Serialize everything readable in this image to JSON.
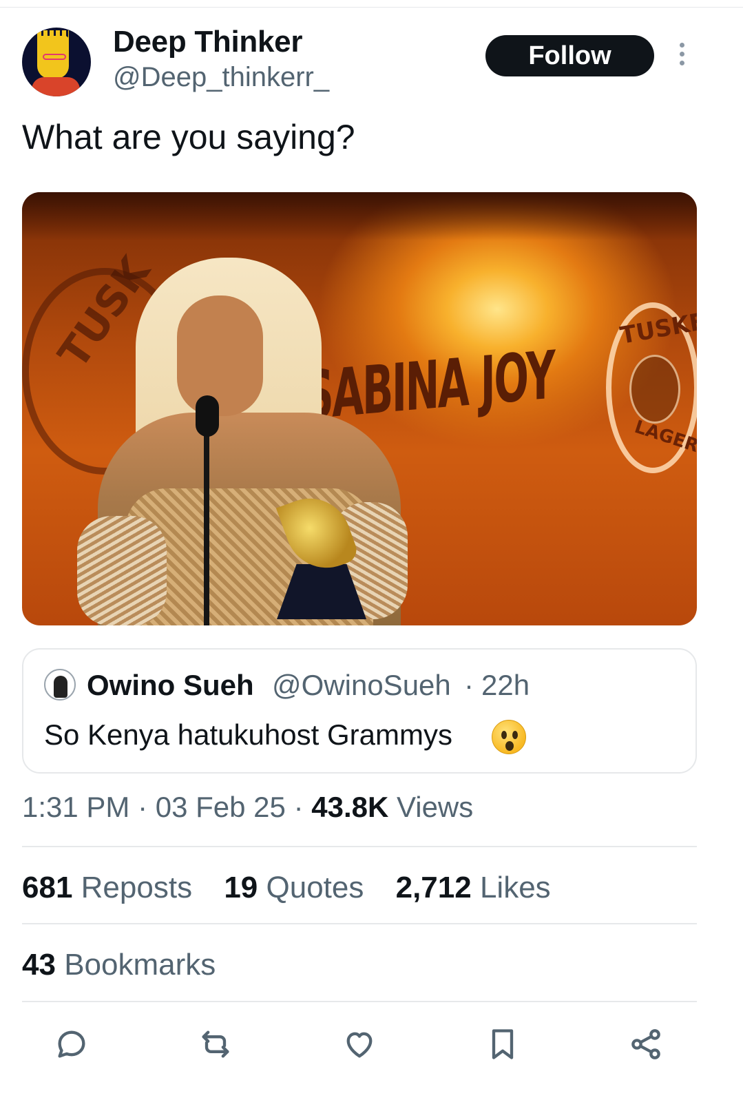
{
  "author": {
    "name": "Deep Thinker",
    "handle": "@Deep_thinkerr_",
    "follow_label": "Follow"
  },
  "tweet": {
    "text": "What are you saying?",
    "media": {
      "sign_text": "SABINA JOY",
      "logo_left_text": "TUSK",
      "logo_right_top": "TUSKER",
      "logo_right_bottom": "LAGER"
    }
  },
  "quote": {
    "name": "Owino Sueh",
    "handle": "@OwinoSueh",
    "separator": "·",
    "time": "22h",
    "text": "So Kenya hatukuhost Grammys",
    "emoji": "astonished-face"
  },
  "meta": {
    "time": "1:31 PM",
    "date": "03 Feb 25",
    "views_count": "43.8K",
    "views_label": "Views"
  },
  "stats": {
    "reposts_count": "681",
    "reposts_label": "Reposts",
    "quotes_count": "19",
    "quotes_label": "Quotes",
    "likes_count": "2,712",
    "likes_label": "Likes",
    "bookmarks_count": "43",
    "bookmarks_label": "Bookmarks"
  },
  "actions": [
    "reply-icon",
    "repost-icon",
    "like-icon",
    "bookmark-icon",
    "share-icon"
  ],
  "colors": {
    "text_primary": "#0f1419",
    "text_secondary": "#536471",
    "border": "#e6e8ea",
    "follow_bg": "#0f1419"
  }
}
